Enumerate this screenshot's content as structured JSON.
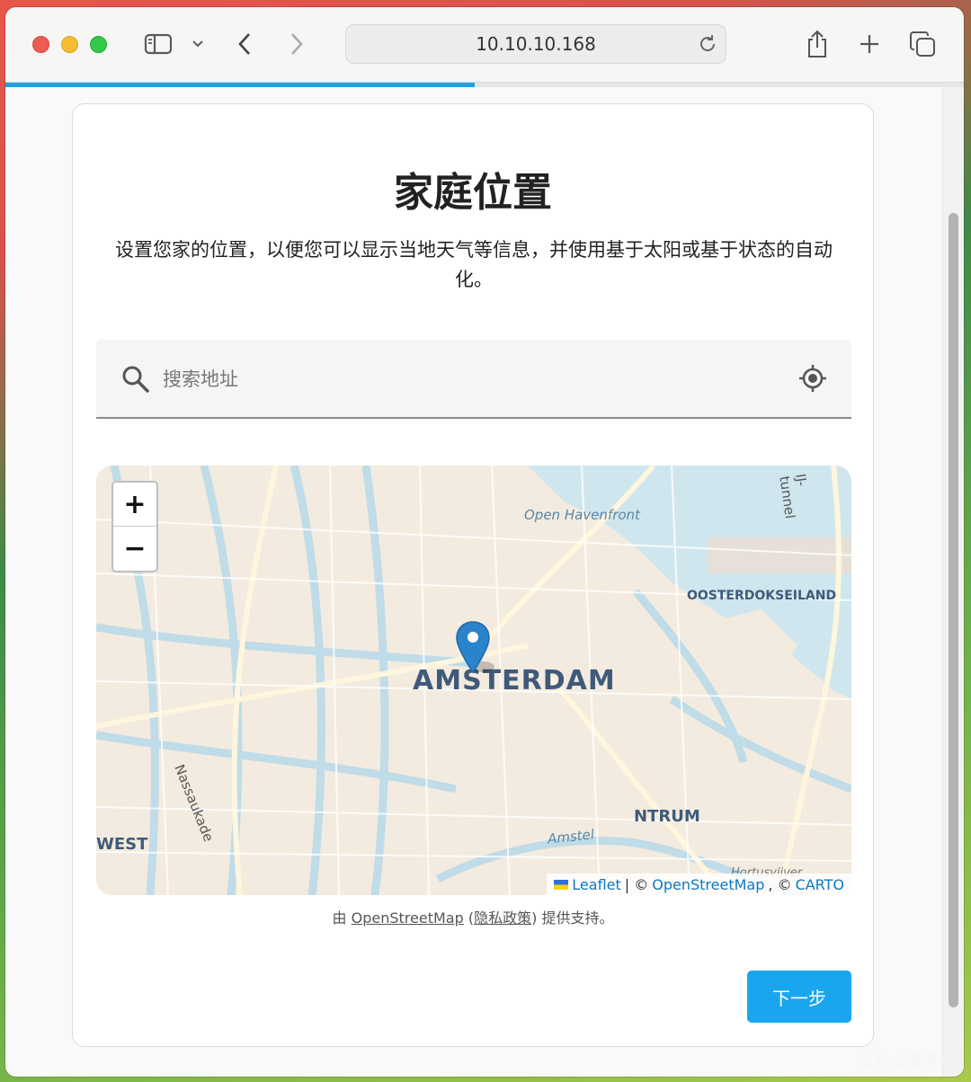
{
  "browser": {
    "url": "10.10.10.168",
    "load_progress": 0.49
  },
  "page": {
    "title": "家庭位置",
    "description": "设置您家的位置，以便您可以显示当地天气等信息，并使用基于太阳或基于状态的自动化。",
    "search": {
      "placeholder": "搜索地址",
      "value": ""
    },
    "map": {
      "zoom_in": "+",
      "zoom_out": "−",
      "labels": {
        "city": "AMSTERDAM",
        "havenfront": "Open Havenfront",
        "oosterdok": "OOSTERDOKSEILAND",
        "centrum": "NTRUM",
        "west": "WEST",
        "nassaukade": "Nassaukade",
        "ij_tunnel": "IJ-tunnel",
        "amstel": "Amstel",
        "hortus": "Hortusvijver"
      },
      "attribution": {
        "leaflet": "Leaflet",
        "sep1": "| ©",
        "osm": "OpenStreetMap",
        "sep2": ", ©",
        "carto": "CARTO"
      }
    },
    "credit": {
      "prefix": "由",
      "osm": "OpenStreetMap",
      "open_paren": "(",
      "privacy": "隐私政策",
      "suffix": ") 提供支持。"
    },
    "next_button": "下一步"
  },
  "watermark": "值 什么值得买",
  "colors": {
    "accent": "#1aa6ee",
    "progress": "#1fa0e0",
    "pin": "#2a83cb"
  }
}
